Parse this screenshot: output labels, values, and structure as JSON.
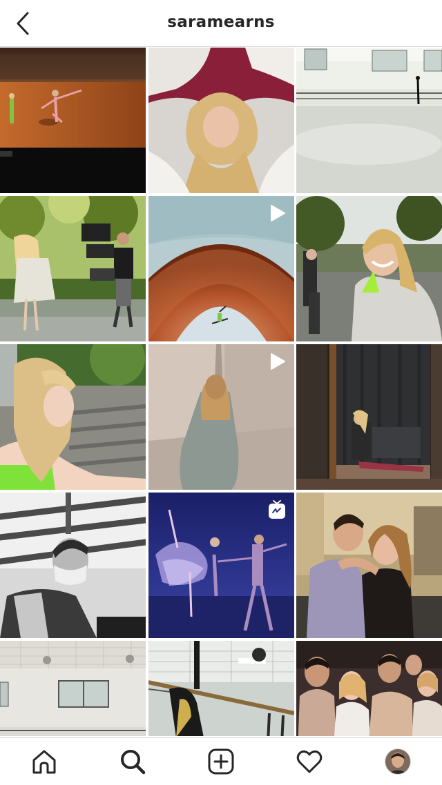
{
  "header": {
    "username": "saramearns",
    "back_icon": "chevron-left-icon"
  },
  "grid": {
    "posts": [
      {
        "name": "post-dancer-stage",
        "badge": "none"
      },
      {
        "name": "post-hair-spread-bed",
        "badge": "none"
      },
      {
        "name": "post-empty-studio",
        "badge": "none"
      },
      {
        "name": "post-film-crew-park",
        "badge": "none"
      },
      {
        "name": "post-bandshell-leap",
        "badge": "video"
      },
      {
        "name": "post-smiling-park",
        "badge": "none"
      },
      {
        "name": "post-profile-bleachers",
        "badge": "none"
      },
      {
        "name": "post-raincoat-wall",
        "badge": "video"
      },
      {
        "name": "post-backstage-mirror",
        "badge": "none"
      },
      {
        "name": "post-masked-barre-bw",
        "badge": "none"
      },
      {
        "name": "post-ballet-duet",
        "badge": "igtv"
      },
      {
        "name": "post-couple-portrait",
        "badge": "none"
      },
      {
        "name": "post-studio-floor-lying",
        "badge": "none"
      },
      {
        "name": "post-barre-split",
        "badge": "none"
      },
      {
        "name": "post-group-dancers",
        "badge": "none"
      }
    ]
  },
  "tabbar": {
    "items": [
      {
        "name": "home",
        "icon": "home-icon"
      },
      {
        "name": "search",
        "icon": "search-icon",
        "active": true
      },
      {
        "name": "new-post",
        "icon": "plus-square-icon"
      },
      {
        "name": "activity",
        "icon": "heart-icon"
      },
      {
        "name": "profile",
        "icon": "avatar"
      }
    ]
  },
  "colors": {
    "text": "#262626",
    "divider": "#dbdbdb",
    "background": "#ffffff"
  }
}
